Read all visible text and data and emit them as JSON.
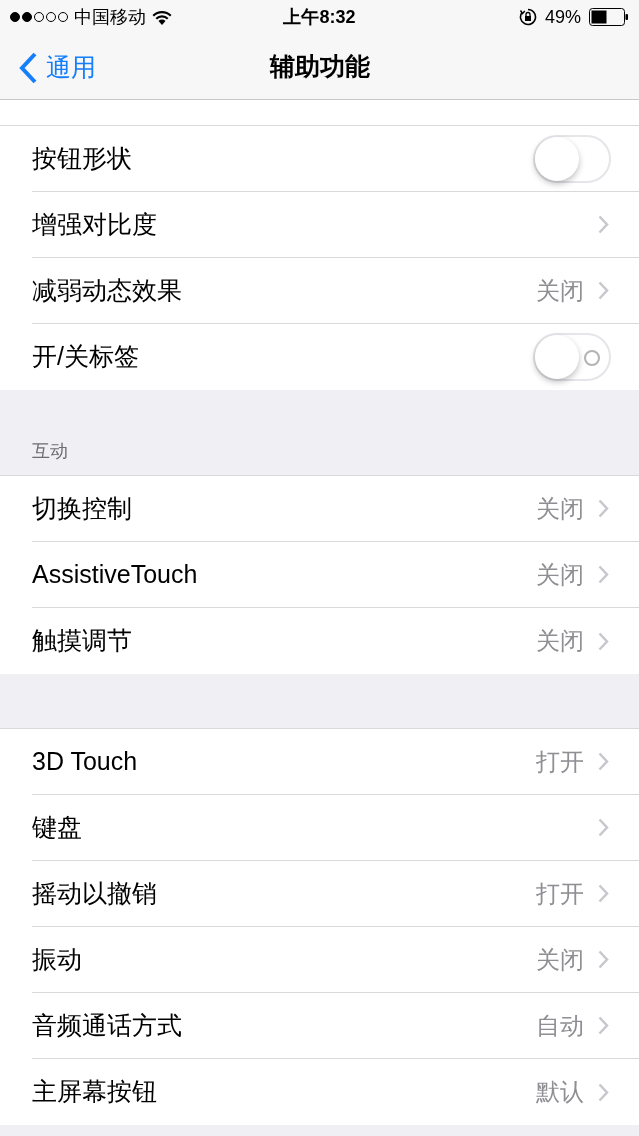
{
  "status_bar": {
    "carrier": "中国移动",
    "time": "上午8:32",
    "battery": "49%"
  },
  "nav": {
    "back": "通用",
    "title": "辅助功能"
  },
  "groups": [
    {
      "rows": [
        {
          "kind": "toggle",
          "label": "按钮形状",
          "on": false,
          "shows_label": false
        },
        {
          "kind": "link",
          "label": "增强对比度"
        },
        {
          "kind": "link",
          "label": "减弱动态效果",
          "value": "关闭"
        },
        {
          "kind": "toggle",
          "label": "开/关标签",
          "on": false,
          "shows_label": true
        }
      ]
    },
    {
      "header": "互动",
      "rows": [
        {
          "kind": "link",
          "label": "切换控制",
          "value": "关闭"
        },
        {
          "kind": "link",
          "label": "AssistiveTouch",
          "value": "关闭"
        },
        {
          "kind": "link",
          "label": "触摸调节",
          "value": "关闭"
        }
      ]
    },
    {
      "rows": [
        {
          "kind": "link",
          "label": "3D Touch",
          "value": "打开"
        },
        {
          "kind": "link",
          "label": "键盘"
        },
        {
          "kind": "link",
          "label": "摇动以撤销",
          "value": "打开"
        },
        {
          "kind": "link",
          "label": "振动",
          "value": "关闭"
        },
        {
          "kind": "link",
          "label": "音频通话方式",
          "value": "自动"
        },
        {
          "kind": "link",
          "label": "主屏幕按钮",
          "value": "默认"
        }
      ]
    }
  ]
}
